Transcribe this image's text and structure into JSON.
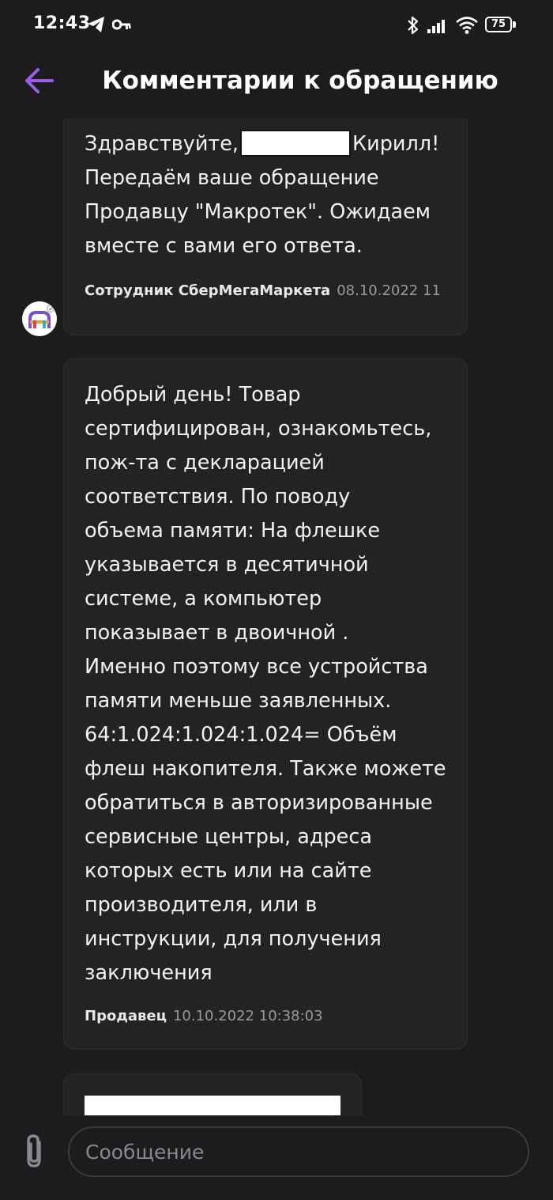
{
  "status_bar": {
    "time": "12:43",
    "battery": "75"
  },
  "header": {
    "title": "Комментарии к обращению"
  },
  "messages": [
    {
      "text_before": "Здравствуйте,",
      "text_after": "Кирилл!\nПередаём ваше обращение\nПродавцу \"Макротек\". Ожидаем\nвместе с вами его ответа.",
      "author": "Сотрудник СберМегаМаркета",
      "time": "08.10.2022 11"
    },
    {
      "text": "Добрый день! Товар\nсертифицирован, ознакомьтесь,\nпож-та с декларацией\nсоответствия. По поводу\nобъема памяти: На флешке\nуказывается в десятичной\nсистеме, а компьютер\nпоказывает в двоичной .\nИменно поэтому все устройства\nпамяти меньше заявленных.\n64:1.024:1.024:1.024= Объём\nфлеш накопителя. Также можете\nобратиться в авторизированные\nсервисные центры, адреса\nкоторых есть или на сайте\nпроизводителя, или в\nинструкции, для получения\nзаключения",
      "author": "Продавец",
      "time": "10.10.2022 10:38:03"
    }
  ],
  "composer": {
    "placeholder": "Сообщение"
  },
  "colors": {
    "accent": "#9b5de5",
    "background": "#1c1c1e",
    "bubble": "#232325"
  },
  "icons": {
    "back": "arrow-left-icon",
    "attach": "paperclip-icon",
    "telegram": "telegram-icon",
    "key": "key-icon",
    "bluetooth": "bluetooth-icon",
    "signal": "signal-icon",
    "wifi": "wifi-icon",
    "battery": "battery-icon"
  }
}
